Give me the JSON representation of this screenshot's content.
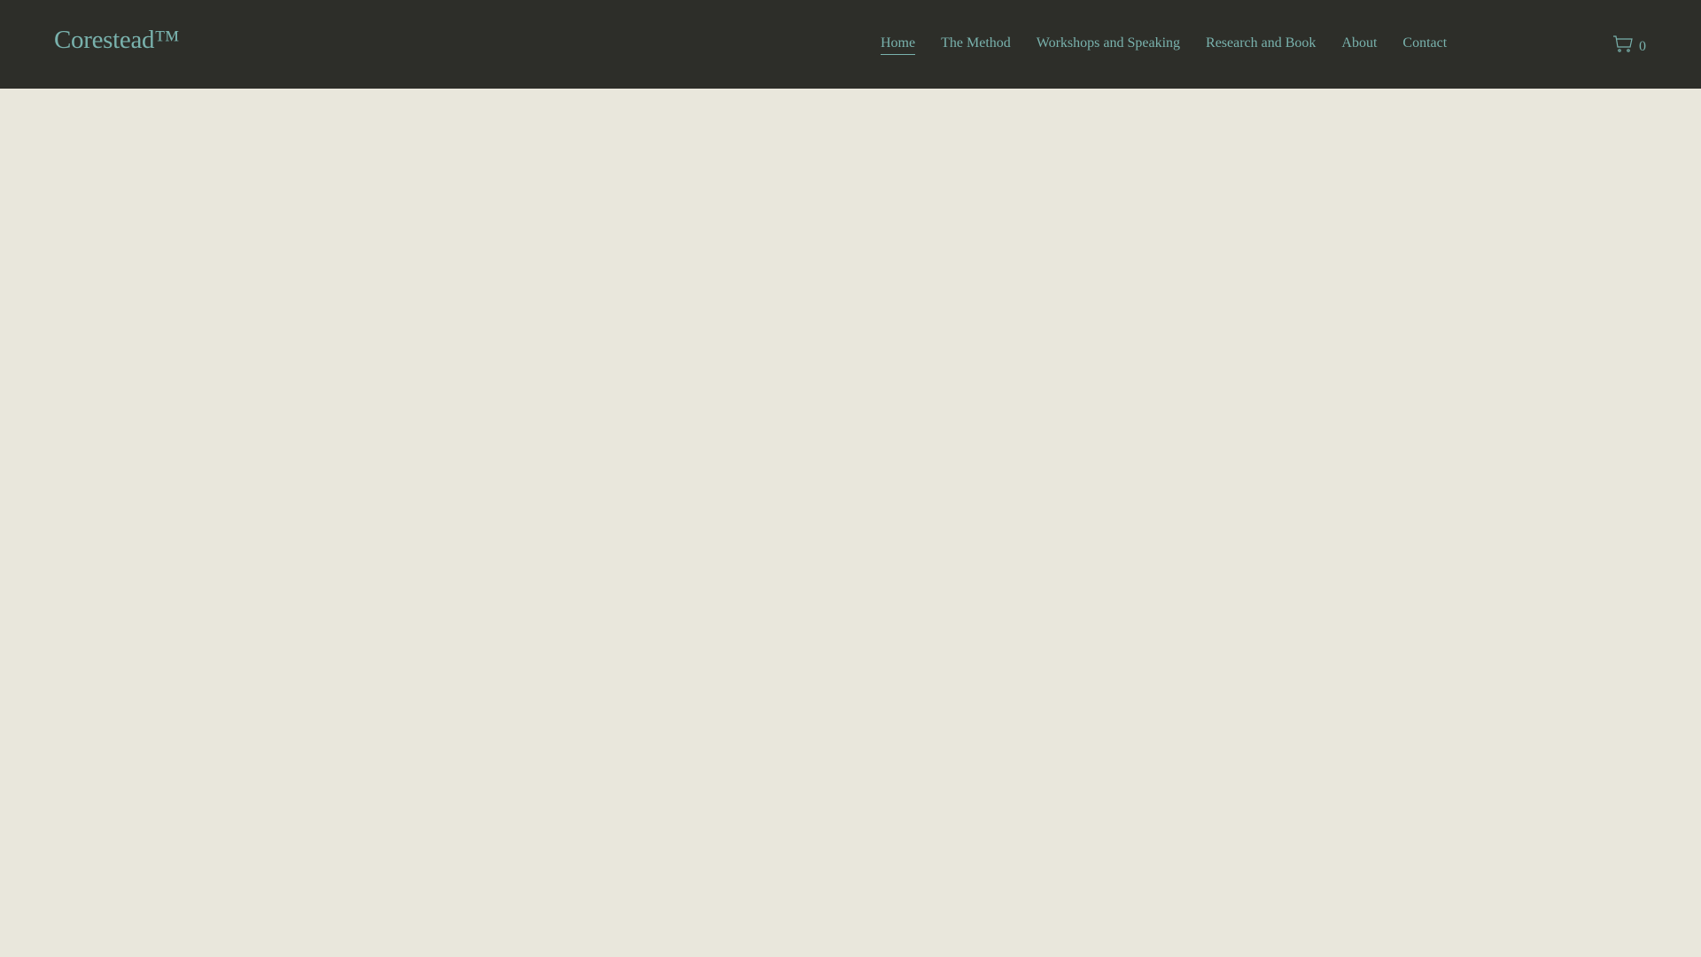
{
  "header": {
    "logo": "Corestead™",
    "nav": [
      {
        "label": "Home",
        "active": true
      },
      {
        "label": "The Method"
      },
      {
        "label": "Workshops and Speaking"
      },
      {
        "label": "Research and Book"
      },
      {
        "label": "About"
      },
      {
        "label": "Contact"
      }
    ],
    "cart": {
      "icon": "cart-icon",
      "count": "0"
    }
  },
  "colors": {
    "header_bg": "#2d2e29",
    "accent": "#79b2ad",
    "page_bg": "#e9e7dc"
  }
}
